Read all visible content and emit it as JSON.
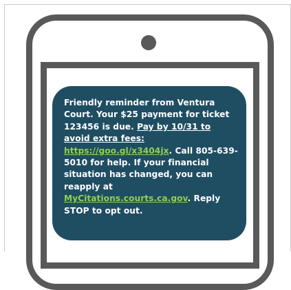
{
  "message": {
    "part1": "Friendly reminder from Ventura Court. Your $25 payment for ticket 123456 is due. ",
    "underlined": "Pay by 10/31 to avoid extra fees:",
    "link1": "https://goo.gl/x3404jx",
    "part2": ". Call 805-639-5010 for help. If your financial situation has changed, you can reapply at ",
    "link2": "MyCitations.courts.ca.gov",
    "part3": ". Reply STOP to opt out."
  },
  "colors": {
    "bubble": "#1f4e63",
    "link": "#92d050",
    "phone": "#595959",
    "text": "#ffffff"
  }
}
